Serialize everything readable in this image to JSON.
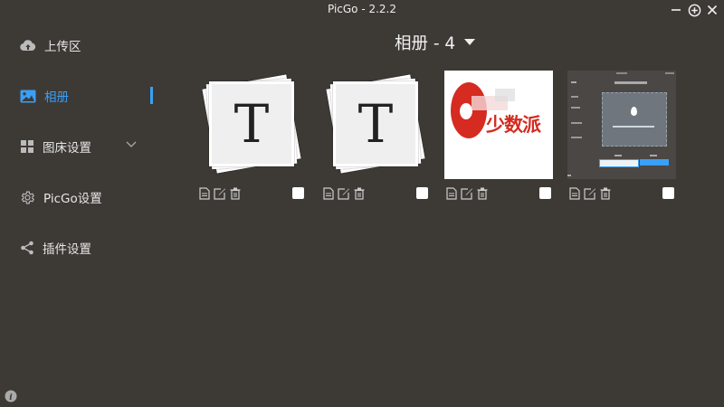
{
  "window": {
    "title": "PicGo - 2.2.2"
  },
  "sidebar": {
    "items": [
      {
        "label": "上传区",
        "icon": "cloud-upload-icon"
      },
      {
        "label": "相册",
        "icon": "image-icon",
        "active": true
      },
      {
        "label": "图床设置",
        "icon": "grid-icon"
      },
      {
        "label": "PicGo设置",
        "icon": "gear-icon"
      },
      {
        "label": "插件设置",
        "icon": "share-icon"
      }
    ]
  },
  "gallery": {
    "title": "相册 - 4",
    "items": [
      {
        "type": "typora-logo",
        "letter": "T"
      },
      {
        "type": "typora-logo",
        "letter": "T"
      },
      {
        "type": "sspai-logo",
        "text": "少数派"
      },
      {
        "type": "screenshot"
      }
    ]
  },
  "colors": {
    "background": "#3d3a36",
    "accent": "#3a9ff5"
  }
}
